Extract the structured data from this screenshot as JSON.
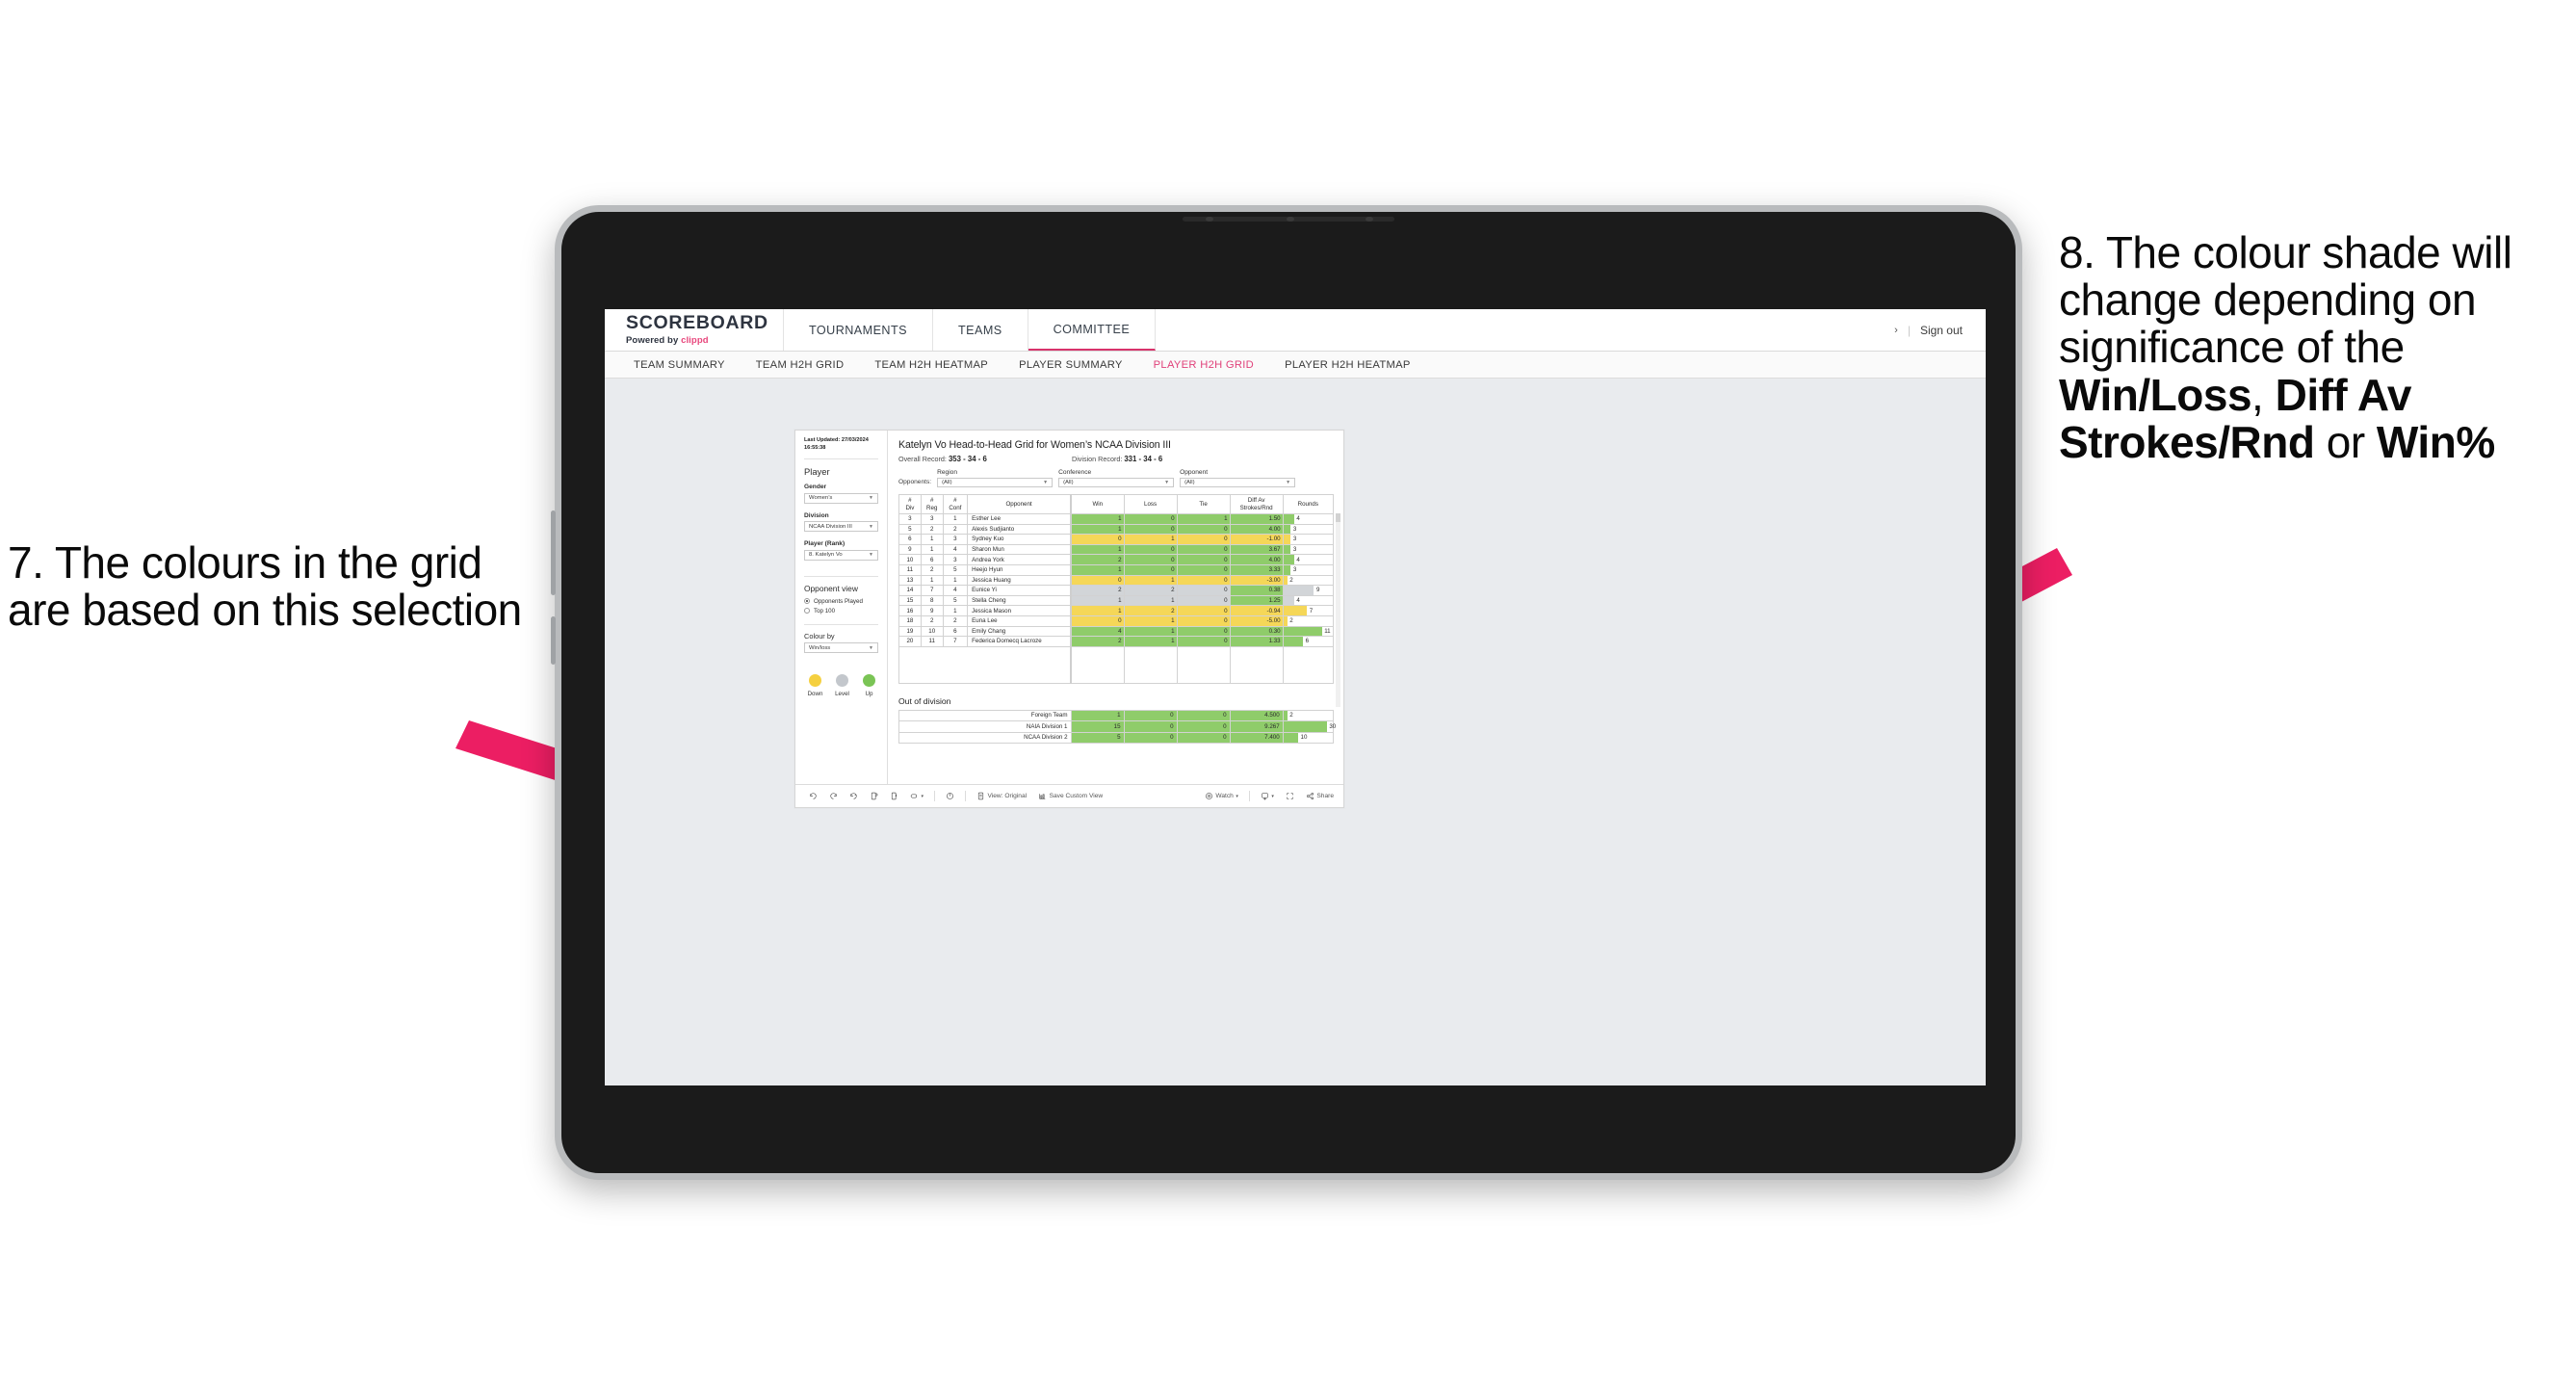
{
  "annotations": {
    "left": "7. The colours in the grid are based on this selection",
    "right_pre": "8. The colour shade will change depending on significance of the ",
    "right_b1": "Win/Loss",
    "right_mid1": ", ",
    "right_b2": "Diff Av Strokes/Rnd",
    "right_mid2": " or ",
    "right_b3": "Win%",
    "arrow_color": "#ec1e63"
  },
  "header": {
    "brand_title": "SCOREBOARD",
    "brand_sub_pre": "Powered by ",
    "brand_sub_accent": "clippd",
    "nav": [
      {
        "label": "TOURNAMENTS",
        "active": false
      },
      {
        "label": "TEAMS",
        "active": false
      },
      {
        "label": "COMMITTEE",
        "active": true
      }
    ],
    "chevron": "›",
    "divider": "|",
    "sign_out": "Sign out",
    "accent": "#d8336b"
  },
  "subnav": [
    {
      "label": "TEAM SUMMARY",
      "active": false
    },
    {
      "label": "TEAM H2H GRID",
      "active": false
    },
    {
      "label": "TEAM H2H HEATMAP",
      "active": false
    },
    {
      "label": "PLAYER SUMMARY",
      "active": false
    },
    {
      "label": "PLAYER H2H GRID",
      "active": true
    },
    {
      "label": "PLAYER H2H HEATMAP",
      "active": false
    }
  ],
  "sidebar": {
    "last_updated": "Last Updated: 27/03/2024 16:55:38",
    "section_title": "Player",
    "gender_label": "Gender",
    "gender_value": "Women’s",
    "division_label": "Division",
    "division_value": "NCAA Division III",
    "player_label": "Player (Rank)",
    "player_value": "8. Katelyn Vo",
    "opponent_view_title": "Opponent view",
    "opponent_view_options": [
      {
        "label": "Opponents Played",
        "selected": true
      },
      {
        "label": "Top 100",
        "selected": false
      }
    ],
    "colour_by_label": "Colour by",
    "colour_by_value": "Win/loss",
    "legend": [
      {
        "label": "Down",
        "color": "#f5d03f"
      },
      {
        "label": "Level",
        "color": "#c3c7cc"
      },
      {
        "label": "Up",
        "color": "#7ac455"
      }
    ]
  },
  "main": {
    "title": "Katelyn Vo Head-to-Head Grid for Women’s NCAA Division III",
    "overall_record_label": "Overall Record:",
    "overall_record_value": "353 -  34 - 6",
    "division_record_label": "Division Record:",
    "division_record_value": "331 -  34 - 6",
    "opponents_label": "Opponents:",
    "filters": [
      {
        "label": "Region",
        "value": "(All)"
      },
      {
        "label": "Conference",
        "value": "(All)"
      },
      {
        "label": "Opponent",
        "value": "(All)"
      }
    ],
    "columns": [
      "# Div",
      "# Reg",
      "# Conf",
      "Opponent",
      "Win",
      "Loss",
      "Tie",
      "Diff Av Strokes/Rnd",
      "Rounds"
    ],
    "columns_split": [
      [
        "#",
        "Div"
      ],
      [
        "#",
        "Reg"
      ],
      [
        "#",
        "Conf"
      ],
      [
        "",
        "Opponent"
      ],
      [
        "",
        "Win"
      ],
      [
        "",
        "Loss"
      ],
      [
        "",
        "Tie"
      ],
      [
        "Diff Av",
        "Strokes/Rnd"
      ],
      [
        "",
        "Rounds"
      ]
    ],
    "rows": [
      {
        "div": "3",
        "reg": "3",
        "conf": "1",
        "opponent": "Esther Lee",
        "win": "1",
        "loss": "0",
        "tie": "1",
        "diff": "1.50",
        "rounds": "4",
        "fill": "#8fcc6a",
        "bar_pct": 22
      },
      {
        "div": "5",
        "reg": "2",
        "conf": "2",
        "opponent": "Alexis Sudjianto",
        "win": "1",
        "loss": "0",
        "tie": "0",
        "diff": "4.00",
        "rounds": "3",
        "fill": "#8fcc6a",
        "bar_pct": 15
      },
      {
        "div": "6",
        "reg": "1",
        "conf": "3",
        "opponent": "Sydney Kuo",
        "win": "0",
        "loss": "1",
        "tie": "0",
        "diff": "-1.00",
        "rounds": "3",
        "fill": "#f5d758",
        "bar_pct": 15
      },
      {
        "div": "9",
        "reg": "1",
        "conf": "4",
        "opponent": "Sharon Mun",
        "win": "1",
        "loss": "0",
        "tie": "0",
        "diff": "3.67",
        "rounds": "3",
        "fill": "#8fcc6a",
        "bar_pct": 15
      },
      {
        "div": "10",
        "reg": "6",
        "conf": "3",
        "opponent": "Andrea York",
        "win": "2",
        "loss": "0",
        "tie": "0",
        "diff": "4.00",
        "rounds": "4",
        "fill": "#8fcc6a",
        "bar_pct": 22
      },
      {
        "div": "11",
        "reg": "2",
        "conf": "5",
        "opponent": "Heejo Hyun",
        "win": "1",
        "loss": "0",
        "tie": "0",
        "diff": "3.33",
        "rounds": "3",
        "fill": "#8fcc6a",
        "bar_pct": 15
      },
      {
        "div": "13",
        "reg": "1",
        "conf": "1",
        "opponent": "Jessica Huang",
        "win": "0",
        "loss": "1",
        "tie": "0",
        "diff": "-3.00",
        "rounds": "2",
        "fill": "#f5d758",
        "bar_pct": 8
      },
      {
        "div": "14",
        "reg": "7",
        "conf": "4",
        "opponent": "Eunice Yi",
        "win": "2",
        "loss": "2",
        "tie": "0",
        "diff": "0.38",
        "rounds": "9",
        "fill": "#d2d5d8",
        "diff_fill": "#8fcc6a",
        "bar_pct": 62
      },
      {
        "div": "15",
        "reg": "8",
        "conf": "5",
        "opponent": "Stella Cheng",
        "win": "1",
        "loss": "1",
        "tie": "0",
        "diff": "1.25",
        "rounds": "4",
        "fill": "#d2d5d8",
        "diff_fill": "#8fcc6a",
        "bar_pct": 22
      },
      {
        "div": "16",
        "reg": "9",
        "conf": "1",
        "opponent": "Jessica Mason",
        "win": "1",
        "loss": "2",
        "tie": "0",
        "diff": "-0.94",
        "rounds": "7",
        "fill": "#f5d758",
        "bar_pct": 48
      },
      {
        "div": "18",
        "reg": "2",
        "conf": "2",
        "opponent": "Euna Lee",
        "win": "0",
        "loss": "1",
        "tie": "0",
        "diff": "-5.00",
        "rounds": "2",
        "fill": "#f5d758",
        "bar_pct": 8
      },
      {
        "div": "19",
        "reg": "10",
        "conf": "6",
        "opponent": "Emily Chang",
        "win": "4",
        "loss": "1",
        "tie": "0",
        "diff": "0.30",
        "rounds": "11",
        "fill": "#8fcc6a",
        "bar_pct": 78
      },
      {
        "div": "20",
        "reg": "11",
        "conf": "7",
        "opponent": "Federica Domecq Lacroze",
        "win": "2",
        "loss": "1",
        "tie": "0",
        "diff": "1.33",
        "rounds": "6",
        "fill": "#8fcc6a",
        "bar_pct": 40
      }
    ],
    "out_of_division_title": "Out of division",
    "out_of_division_rows": [
      {
        "label": "Foreign Team",
        "win": "1",
        "loss": "0",
        "tie": "0",
        "diff": "4.500",
        "rounds": "2",
        "fill": "#8fcc6a",
        "bar_pct": 8
      },
      {
        "label": "NAIA Division 1",
        "win": "15",
        "loss": "0",
        "tie": "0",
        "diff": "9.267",
        "rounds": "30",
        "fill": "#8fcc6a",
        "bar_pct": 88
      },
      {
        "label": "NCAA Division 2",
        "win": "5",
        "loss": "0",
        "tie": "0",
        "diff": "7.400",
        "rounds": "10",
        "fill": "#8fcc6a",
        "bar_pct": 30
      }
    ]
  },
  "toolbar": {
    "view_label": "View: Original",
    "save_label": "Save Custom View",
    "watch_label": "Watch",
    "share_label": "Share",
    "caret": "▾"
  }
}
